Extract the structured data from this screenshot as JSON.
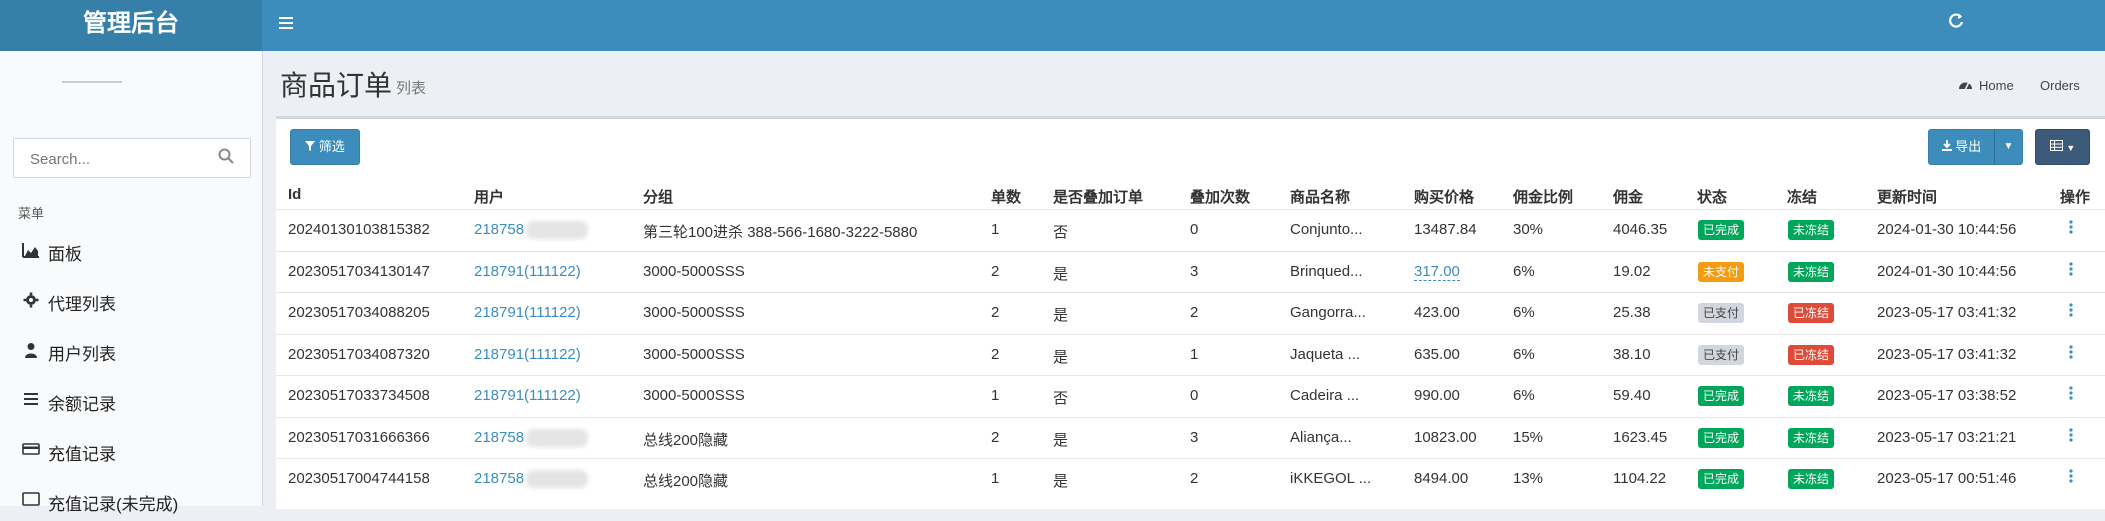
{
  "app": {
    "title": "管理后台"
  },
  "sidebar": {
    "search_placeholder": "Search...",
    "menu_header": "菜单",
    "items": [
      {
        "label": "面板",
        "icon": "area-chart-icon"
      },
      {
        "label": "代理列表",
        "icon": "gear-icon"
      },
      {
        "label": "用户列表",
        "icon": "user-icon"
      },
      {
        "label": "余额记录",
        "icon": "list-icon"
      },
      {
        "label": "充值记录",
        "icon": "credit-card-icon"
      },
      {
        "label": "充值记录(未完成)",
        "icon": "square-icon"
      }
    ]
  },
  "page": {
    "title": "商品订单",
    "subtitle": "列表",
    "breadcrumb": [
      "Home",
      "Orders"
    ]
  },
  "toolbar": {
    "filter_label": "筛选",
    "export_label": "导出"
  },
  "table": {
    "headers": [
      "Id",
      "用户",
      "分组",
      "单数",
      "是否叠加订单",
      "叠加次数",
      "商品名称",
      "购买价格",
      "佣金比例",
      "佣金",
      "状态",
      "冻结",
      "更新时间",
      "操作"
    ],
    "rows": [
      {
        "id": "20240130103815382",
        "user": "218758",
        "user_suffix": "",
        "group": "第三轮100进杀 388-566-1680-3222-5880",
        "count": "1",
        "stacked": "否",
        "stack_times": "0",
        "product": "Conjunto...",
        "price": "13487.84",
        "price_editable": false,
        "ratio": "30%",
        "commission": "4046.35",
        "status": "已完成",
        "status_color": "green",
        "frozen": "未冻结",
        "frozen_color": "green",
        "updated": "2024-01-30 10:44:56"
      },
      {
        "id": "20230517034130147",
        "user": "218791(111122)",
        "user_suffix": "",
        "group": "3000-5000SSS",
        "count": "2",
        "stacked": "是",
        "stack_times": "3",
        "product": "Brinqued...",
        "price": "317.00",
        "price_editable": true,
        "ratio": "6%",
        "commission": "19.02",
        "status": "未支付",
        "status_color": "orange",
        "frozen": "未冻结",
        "frozen_color": "green",
        "updated": "2024-01-30 10:44:56"
      },
      {
        "id": "20230517034088205",
        "user": "218791(111122)",
        "user_suffix": "",
        "group": "3000-5000SSS",
        "count": "2",
        "stacked": "是",
        "stack_times": "2",
        "product": "Gangorra...",
        "price": "423.00",
        "price_editable": false,
        "ratio": "6%",
        "commission": "25.38",
        "status": "已支付",
        "status_color": "grey",
        "frozen": "已冻结",
        "frozen_color": "red",
        "updated": "2023-05-17 03:41:32"
      },
      {
        "id": "20230517034087320",
        "user": "218791(111122)",
        "user_suffix": "",
        "group": "3000-5000SSS",
        "count": "2",
        "stacked": "是",
        "stack_times": "1",
        "product": "Jaqueta ...",
        "price": "635.00",
        "price_editable": false,
        "ratio": "6%",
        "commission": "38.10",
        "status": "已支付",
        "status_color": "grey",
        "frozen": "已冻结",
        "frozen_color": "red",
        "updated": "2023-05-17 03:41:32"
      },
      {
        "id": "20230517033734508",
        "user": "218791(111122)",
        "user_suffix": "",
        "group": "3000-5000SSS",
        "count": "1",
        "stacked": "否",
        "stack_times": "0",
        "product": "Cadeira ...",
        "price": "990.00",
        "price_editable": false,
        "ratio": "6%",
        "commission": "59.40",
        "status": "已完成",
        "status_color": "green",
        "frozen": "未冻结",
        "frozen_color": "green",
        "updated": "2023-05-17 03:38:52"
      },
      {
        "id": "20230517031666366",
        "user": "218758",
        "user_suffix": "",
        "group": "总线200隐藏",
        "count": "2",
        "stacked": "是",
        "stack_times": "3",
        "product": "Aliança...",
        "price": "10823.00",
        "price_editable": false,
        "ratio": "15%",
        "commission": "1623.45",
        "status": "已完成",
        "status_color": "green",
        "frozen": "未冻结",
        "frozen_color": "green",
        "updated": "2023-05-17 03:21:21"
      },
      {
        "id": "20230517004744158",
        "user": "218758",
        "user_suffix": "",
        "group": "总线200隐藏",
        "count": "1",
        "stacked": "是",
        "stack_times": "2",
        "product": "iKKEGOL ...",
        "price": "8494.00",
        "price_editable": false,
        "ratio": "13%",
        "commission": "1104.22",
        "status": "已完成",
        "status_color": "green",
        "frozen": "未冻结",
        "frozen_color": "green",
        "updated": "2023-05-17 00:51:46"
      }
    ]
  },
  "colors": {
    "header": "#3c8dbc",
    "logo_bg": "#367fa9",
    "green": "#00a65a",
    "orange": "#f39c12",
    "grey": "#d2d6de",
    "red": "#dd4b39",
    "link": "#3c8dbc"
  }
}
